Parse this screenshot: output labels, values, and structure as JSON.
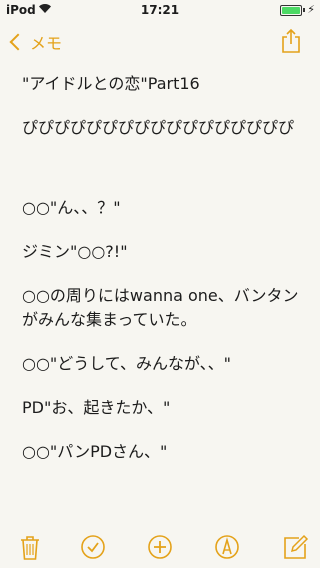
{
  "status": {
    "carrier": "iPod",
    "time": "17:21"
  },
  "nav": {
    "back_label": "メモ"
  },
  "note": {
    "title": "\"アイドルとの恋\"Part16",
    "lines": [
      "ぴぴぴぴぴぴぴぴぴぴぴぴぴぴぴぴぴ",
      "○○\"ん、、？\"",
      "ジミン\"○○?!\"",
      "○○の周りにはwanna one、バンタンがみんな集まっていた。",
      "○○\"どうして、みんなが、、\"",
      "PD\"お、起きたか、\"",
      "○○\"パンPDさん、\""
    ]
  },
  "colors": {
    "accent": "#e4a21a",
    "background": "#f7f6f1",
    "battery": "#4cd964"
  },
  "toolbar": {
    "icons": [
      "trash-icon",
      "checkmark-circle-icon",
      "plus-circle-icon",
      "pen-markup-icon",
      "compose-icon"
    ]
  }
}
